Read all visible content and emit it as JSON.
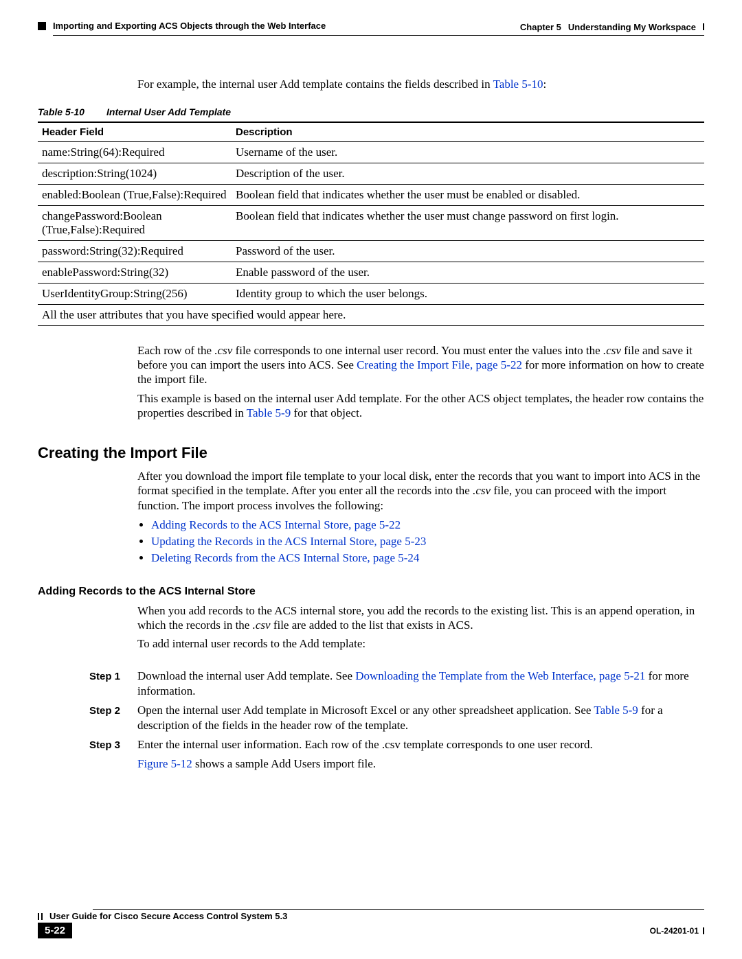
{
  "header": {
    "left": "Importing and Exporting ACS Objects through the Web Interface",
    "right_chapter": "Chapter 5",
    "right_title": "Understanding My Workspace"
  },
  "intro": {
    "p1_a": "For example, the internal user Add template contains the fields described in ",
    "p1_link": "Table 5-10",
    "p1_b": ":"
  },
  "table": {
    "caption_num": "Table 5-10",
    "caption_title": "Internal User Add Template",
    "head1": "Header Field",
    "head2": "Description",
    "rows": [
      {
        "f": "name:String(64):Required",
        "d": "Username of the user."
      },
      {
        "f": "description:String(1024)",
        "d": "Description of the user."
      },
      {
        "f": "enabled:Boolean (True,False):Required",
        "d": "Boolean field that indicates whether the user must be enabled or disabled."
      },
      {
        "f": "changePassword:Boolean (True,False):Required",
        "d": "Boolean field that indicates whether the user must change password on first login."
      },
      {
        "f": "password:String(32):Required",
        "d": "Password of the user."
      },
      {
        "f": "enablePassword:String(32)",
        "d": "Enable password of the user."
      },
      {
        "f": "UserIdentityGroup:String(256)",
        "d": "Identity group to which the user belongs."
      }
    ],
    "footer_row": "All the user attributes that you have specified would appear here."
  },
  "after_table": {
    "p1_a": "Each row of the ",
    "p1_i1": ".csv",
    "p1_b": " file corresponds to one internal user record. You must enter the values into the ",
    "p1_i2": ".csv",
    "p1_c": " file and save it before you can import the users into ACS. See ",
    "p1_link": "Creating the Import File, page 5-22",
    "p1_d": " for more information on how to create the import file.",
    "p2_a": "This example is based on the internal user Add template. For the other ACS object templates, the header row contains the properties described in ",
    "p2_link": "Table 5-9",
    "p2_b": " for that object."
  },
  "h2": "Creating the Import File",
  "creating": {
    "p1_a": "After you download the import file template to your local disk, enter the records that you want to import into ACS in the format specified in the template. After you enter all the records into the ",
    "p1_i": ".csv",
    "p1_b": " file, you can proceed with the import function. The import process involves the following:"
  },
  "bullets": [
    "Adding Records to the ACS Internal Store, page 5-22",
    "Updating the Records in the ACS Internal Store, page 5-23",
    "Deleting Records from the ACS Internal Store, page 5-24"
  ],
  "h3": "Adding Records to the ACS Internal Store",
  "adding": {
    "p1_a": "When you add records to the ACS internal store, you add the records to the existing list. This is an append operation, in which the records in the ",
    "p1_i": ".csv",
    "p1_b": " file are added to the list that exists in ACS.",
    "p2": "To add internal user records to the Add template:"
  },
  "steps": [
    {
      "label": "Step 1",
      "a": "Download the internal user Add template. See ",
      "link": "Downloading the Template from the Web Interface, page 5-21",
      "b": " for more information."
    },
    {
      "label": "Step 2",
      "a": "Open the internal user Add template in Microsoft Excel or any other spreadsheet application. See ",
      "link": "Table 5-9",
      "b": " for a description of the fields in the header row of the template."
    },
    {
      "label": "Step 3",
      "a": "Enter the internal user information. Each row of the .csv template corresponds to one user record.",
      "link": "",
      "b": ""
    }
  ],
  "step3_extra_link": "Figure 5-12",
  "step3_extra_text": " shows a sample Add Users import file.",
  "footer": {
    "guide": "User Guide for Cisco Secure Access Control System 5.3",
    "page": "5-22",
    "docid": "OL-24201-01"
  }
}
